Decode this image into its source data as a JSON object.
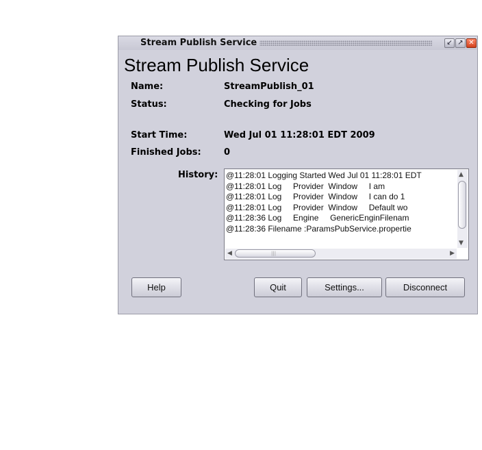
{
  "window": {
    "title": "Stream Publish Service",
    "controls": {
      "minimize": "↙",
      "maximize": "↗",
      "close": "✕"
    }
  },
  "header": {
    "title": "Stream Publish Service"
  },
  "info": {
    "name_label": "Name:",
    "name_value": "StreamPublish_01",
    "status_label": "Status:",
    "status_value": "Checking for Jobs",
    "start_label": "Start Time:",
    "start_value": "Wed Jul 01 11:28:01 EDT 2009",
    "finished_label": "Finished Jobs:",
    "finished_value": "0"
  },
  "history": {
    "label": "History:",
    "lines": [
      "@11:28:01 Logging Started Wed Jul 01 11:28:01 EDT",
      "@11:28:01 Log     Provider  Window     I am",
      "@11:28:01 Log     Provider  Window     I can do 1",
      "@11:28:01 Log     Provider  Window     Default wo",
      "@11:28:36 Log     Engine     GenericEnginFilenam",
      "@11:28:36 Filename :ParamsPubService.propertie"
    ]
  },
  "buttons": {
    "help": "Help",
    "quit": "Quit",
    "settings": "Settings...",
    "disconnect": "Disconnect"
  }
}
